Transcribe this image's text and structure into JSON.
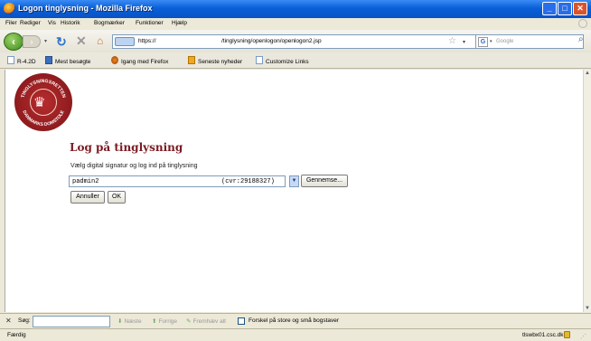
{
  "window": {
    "title": "Logon tinglysning - Mozilla Firefox"
  },
  "menu": [
    "Filer",
    "Rediger",
    "Vis",
    "Historik",
    "Bogmærker",
    "Funktioner",
    "Hjælp"
  ],
  "nav": {
    "url_prefix": "https://",
    "url_path": "/tinglysning/openlogon/openlogon2.jsp",
    "search_placeholder": "Google"
  },
  "bookmarks": [
    "R-4.2D",
    "Mest besøgte",
    "Igang med Firefox",
    "Seneste nyheder",
    "Customize Links"
  ],
  "page": {
    "heading": "Log på tinglysning",
    "subtitle": "Vælg digital signatur og log ind på tinglysning",
    "signature": {
      "name": "padmin2",
      "cvr": "(cvr:29188327)"
    },
    "browse_label": "Gennemse...",
    "cancel_label": "Annuller",
    "ok_label": "OK",
    "seal": {
      "top_text": "TINGLYSNINGSRETTEN",
      "bottom_text": "DANMARKS DOMSTOLE"
    }
  },
  "findbar": {
    "label": "Søg:",
    "next": "Næste",
    "previous": "Forrige",
    "highlight": "Fremhæv alt",
    "match_case": "Forskel på store og små bogstaver"
  },
  "status": {
    "text": "Færdig",
    "host": "tlswbx01.csc.dk"
  },
  "colors": {
    "heading": "#7a1a22",
    "seal": "#8e1b1e",
    "titlebar": "#0a5fd8"
  }
}
